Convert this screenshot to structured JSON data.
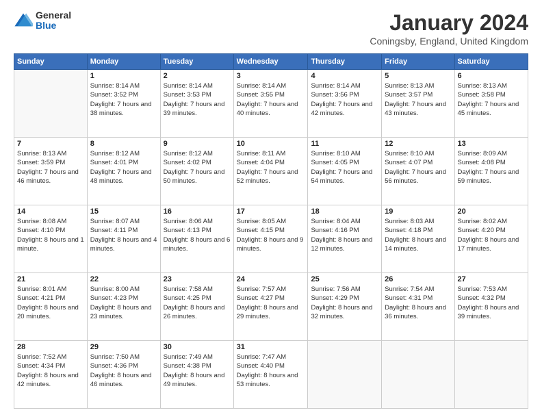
{
  "logo": {
    "general": "General",
    "blue": "Blue"
  },
  "title": "January 2024",
  "location": "Coningsby, England, United Kingdom",
  "days_header": [
    "Sunday",
    "Monday",
    "Tuesday",
    "Wednesday",
    "Thursday",
    "Friday",
    "Saturday"
  ],
  "weeks": [
    [
      {
        "day": "",
        "sunrise": "",
        "sunset": "",
        "daylight": "",
        "empty": true
      },
      {
        "day": "1",
        "sunrise": "Sunrise: 8:14 AM",
        "sunset": "Sunset: 3:52 PM",
        "daylight": "Daylight: 7 hours and 38 minutes.",
        "empty": false
      },
      {
        "day": "2",
        "sunrise": "Sunrise: 8:14 AM",
        "sunset": "Sunset: 3:53 PM",
        "daylight": "Daylight: 7 hours and 39 minutes.",
        "empty": false
      },
      {
        "day": "3",
        "sunrise": "Sunrise: 8:14 AM",
        "sunset": "Sunset: 3:55 PM",
        "daylight": "Daylight: 7 hours and 40 minutes.",
        "empty": false
      },
      {
        "day": "4",
        "sunrise": "Sunrise: 8:14 AM",
        "sunset": "Sunset: 3:56 PM",
        "daylight": "Daylight: 7 hours and 42 minutes.",
        "empty": false
      },
      {
        "day": "5",
        "sunrise": "Sunrise: 8:13 AM",
        "sunset": "Sunset: 3:57 PM",
        "daylight": "Daylight: 7 hours and 43 minutes.",
        "empty": false
      },
      {
        "day": "6",
        "sunrise": "Sunrise: 8:13 AM",
        "sunset": "Sunset: 3:58 PM",
        "daylight": "Daylight: 7 hours and 45 minutes.",
        "empty": false
      }
    ],
    [
      {
        "day": "7",
        "sunrise": "Sunrise: 8:13 AM",
        "sunset": "Sunset: 3:59 PM",
        "daylight": "Daylight: 7 hours and 46 minutes.",
        "empty": false
      },
      {
        "day": "8",
        "sunrise": "Sunrise: 8:12 AM",
        "sunset": "Sunset: 4:01 PM",
        "daylight": "Daylight: 7 hours and 48 minutes.",
        "empty": false
      },
      {
        "day": "9",
        "sunrise": "Sunrise: 8:12 AM",
        "sunset": "Sunset: 4:02 PM",
        "daylight": "Daylight: 7 hours and 50 minutes.",
        "empty": false
      },
      {
        "day": "10",
        "sunrise": "Sunrise: 8:11 AM",
        "sunset": "Sunset: 4:04 PM",
        "daylight": "Daylight: 7 hours and 52 minutes.",
        "empty": false
      },
      {
        "day": "11",
        "sunrise": "Sunrise: 8:10 AM",
        "sunset": "Sunset: 4:05 PM",
        "daylight": "Daylight: 7 hours and 54 minutes.",
        "empty": false
      },
      {
        "day": "12",
        "sunrise": "Sunrise: 8:10 AM",
        "sunset": "Sunset: 4:07 PM",
        "daylight": "Daylight: 7 hours and 56 minutes.",
        "empty": false
      },
      {
        "day": "13",
        "sunrise": "Sunrise: 8:09 AM",
        "sunset": "Sunset: 4:08 PM",
        "daylight": "Daylight: 7 hours and 59 minutes.",
        "empty": false
      }
    ],
    [
      {
        "day": "14",
        "sunrise": "Sunrise: 8:08 AM",
        "sunset": "Sunset: 4:10 PM",
        "daylight": "Daylight: 8 hours and 1 minute.",
        "empty": false
      },
      {
        "day": "15",
        "sunrise": "Sunrise: 8:07 AM",
        "sunset": "Sunset: 4:11 PM",
        "daylight": "Daylight: 8 hours and 4 minutes.",
        "empty": false
      },
      {
        "day": "16",
        "sunrise": "Sunrise: 8:06 AM",
        "sunset": "Sunset: 4:13 PM",
        "daylight": "Daylight: 8 hours and 6 minutes.",
        "empty": false
      },
      {
        "day": "17",
        "sunrise": "Sunrise: 8:05 AM",
        "sunset": "Sunset: 4:15 PM",
        "daylight": "Daylight: 8 hours and 9 minutes.",
        "empty": false
      },
      {
        "day": "18",
        "sunrise": "Sunrise: 8:04 AM",
        "sunset": "Sunset: 4:16 PM",
        "daylight": "Daylight: 8 hours and 12 minutes.",
        "empty": false
      },
      {
        "day": "19",
        "sunrise": "Sunrise: 8:03 AM",
        "sunset": "Sunset: 4:18 PM",
        "daylight": "Daylight: 8 hours and 14 minutes.",
        "empty": false
      },
      {
        "day": "20",
        "sunrise": "Sunrise: 8:02 AM",
        "sunset": "Sunset: 4:20 PM",
        "daylight": "Daylight: 8 hours and 17 minutes.",
        "empty": false
      }
    ],
    [
      {
        "day": "21",
        "sunrise": "Sunrise: 8:01 AM",
        "sunset": "Sunset: 4:21 PM",
        "daylight": "Daylight: 8 hours and 20 minutes.",
        "empty": false
      },
      {
        "day": "22",
        "sunrise": "Sunrise: 8:00 AM",
        "sunset": "Sunset: 4:23 PM",
        "daylight": "Daylight: 8 hours and 23 minutes.",
        "empty": false
      },
      {
        "day": "23",
        "sunrise": "Sunrise: 7:58 AM",
        "sunset": "Sunset: 4:25 PM",
        "daylight": "Daylight: 8 hours and 26 minutes.",
        "empty": false
      },
      {
        "day": "24",
        "sunrise": "Sunrise: 7:57 AM",
        "sunset": "Sunset: 4:27 PM",
        "daylight": "Daylight: 8 hours and 29 minutes.",
        "empty": false
      },
      {
        "day": "25",
        "sunrise": "Sunrise: 7:56 AM",
        "sunset": "Sunset: 4:29 PM",
        "daylight": "Daylight: 8 hours and 32 minutes.",
        "empty": false
      },
      {
        "day": "26",
        "sunrise": "Sunrise: 7:54 AM",
        "sunset": "Sunset: 4:31 PM",
        "daylight": "Daylight: 8 hours and 36 minutes.",
        "empty": false
      },
      {
        "day": "27",
        "sunrise": "Sunrise: 7:53 AM",
        "sunset": "Sunset: 4:32 PM",
        "daylight": "Daylight: 8 hours and 39 minutes.",
        "empty": false
      }
    ],
    [
      {
        "day": "28",
        "sunrise": "Sunrise: 7:52 AM",
        "sunset": "Sunset: 4:34 PM",
        "daylight": "Daylight: 8 hours and 42 minutes.",
        "empty": false
      },
      {
        "day": "29",
        "sunrise": "Sunrise: 7:50 AM",
        "sunset": "Sunset: 4:36 PM",
        "daylight": "Daylight: 8 hours and 46 minutes.",
        "empty": false
      },
      {
        "day": "30",
        "sunrise": "Sunrise: 7:49 AM",
        "sunset": "Sunset: 4:38 PM",
        "daylight": "Daylight: 8 hours and 49 minutes.",
        "empty": false
      },
      {
        "day": "31",
        "sunrise": "Sunrise: 7:47 AM",
        "sunset": "Sunset: 4:40 PM",
        "daylight": "Daylight: 8 hours and 53 minutes.",
        "empty": false
      },
      {
        "day": "",
        "sunrise": "",
        "sunset": "",
        "daylight": "",
        "empty": true
      },
      {
        "day": "",
        "sunrise": "",
        "sunset": "",
        "daylight": "",
        "empty": true
      },
      {
        "day": "",
        "sunrise": "",
        "sunset": "",
        "daylight": "",
        "empty": true
      }
    ]
  ]
}
